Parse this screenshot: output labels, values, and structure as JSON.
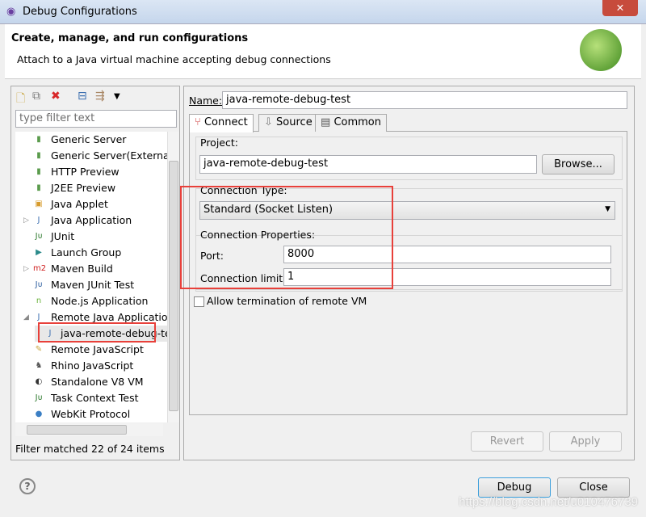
{
  "window": {
    "title": "Debug Configurations",
    "close": "✕"
  },
  "header": {
    "title": "Create, manage, and run configurations",
    "subtitle": "Attach to a Java virtual machine accepting debug connections"
  },
  "left": {
    "filter_placeholder": "type filter text",
    "items": [
      {
        "label": "Generic Server",
        "icon": "server-icon"
      },
      {
        "label": "Generic Server(External",
        "icon": "server-icon"
      },
      {
        "label": "HTTP Preview",
        "icon": "server-icon"
      },
      {
        "label": "J2EE Preview",
        "icon": "server-icon"
      },
      {
        "label": "Java Applet",
        "icon": "applet-icon"
      },
      {
        "label": "Java Application",
        "icon": "java-app-icon"
      },
      {
        "label": "JUnit",
        "icon": "junit-icon"
      },
      {
        "label": "Launch Group",
        "icon": "launch-group-icon"
      },
      {
        "label": "Maven Build",
        "icon": "m2-icon"
      },
      {
        "label": "Maven JUnit Test",
        "icon": "maven-junit-icon"
      },
      {
        "label": "Node.js Application",
        "icon": "nodejs-icon"
      },
      {
        "label": "Remote Java Application",
        "icon": "remote-java-icon"
      },
      {
        "label": "java-remote-debug-test",
        "icon": "remote-java-icon"
      },
      {
        "label": "Remote JavaScript",
        "icon": "remote-js-icon"
      },
      {
        "label": "Rhino JavaScript",
        "icon": "rhino-icon"
      },
      {
        "label": "Standalone V8 VM",
        "icon": "v8-icon"
      },
      {
        "label": "Task Context Test",
        "icon": "junit-icon"
      },
      {
        "label": "WebKit Protocol",
        "icon": "webkit-icon"
      }
    ],
    "filter_status": "Filter matched 22 of 24 items"
  },
  "right": {
    "name_label": "Name:",
    "name_value": "java-remote-debug-test",
    "tabs": [
      "Connect",
      "Source",
      "Common"
    ],
    "project_label": "Project:",
    "project_value": "java-remote-debug-test",
    "browse": "Browse...",
    "conn_type_label": "Connection Type:",
    "conn_type_value": "Standard (Socket Listen)",
    "conn_props_label": "Connection Properties:",
    "port_label": "Port:",
    "port_value": "8000",
    "limit_label": "Connection limit:",
    "limit_value": "1",
    "allow_term": "Allow termination of remote VM",
    "allow_term_checked": false,
    "revert": "Revert",
    "apply": "Apply"
  },
  "footer": {
    "help": "?",
    "debug": "Debug",
    "close": "Close"
  },
  "watermark": "https://blog.csdn.net/u010476739"
}
